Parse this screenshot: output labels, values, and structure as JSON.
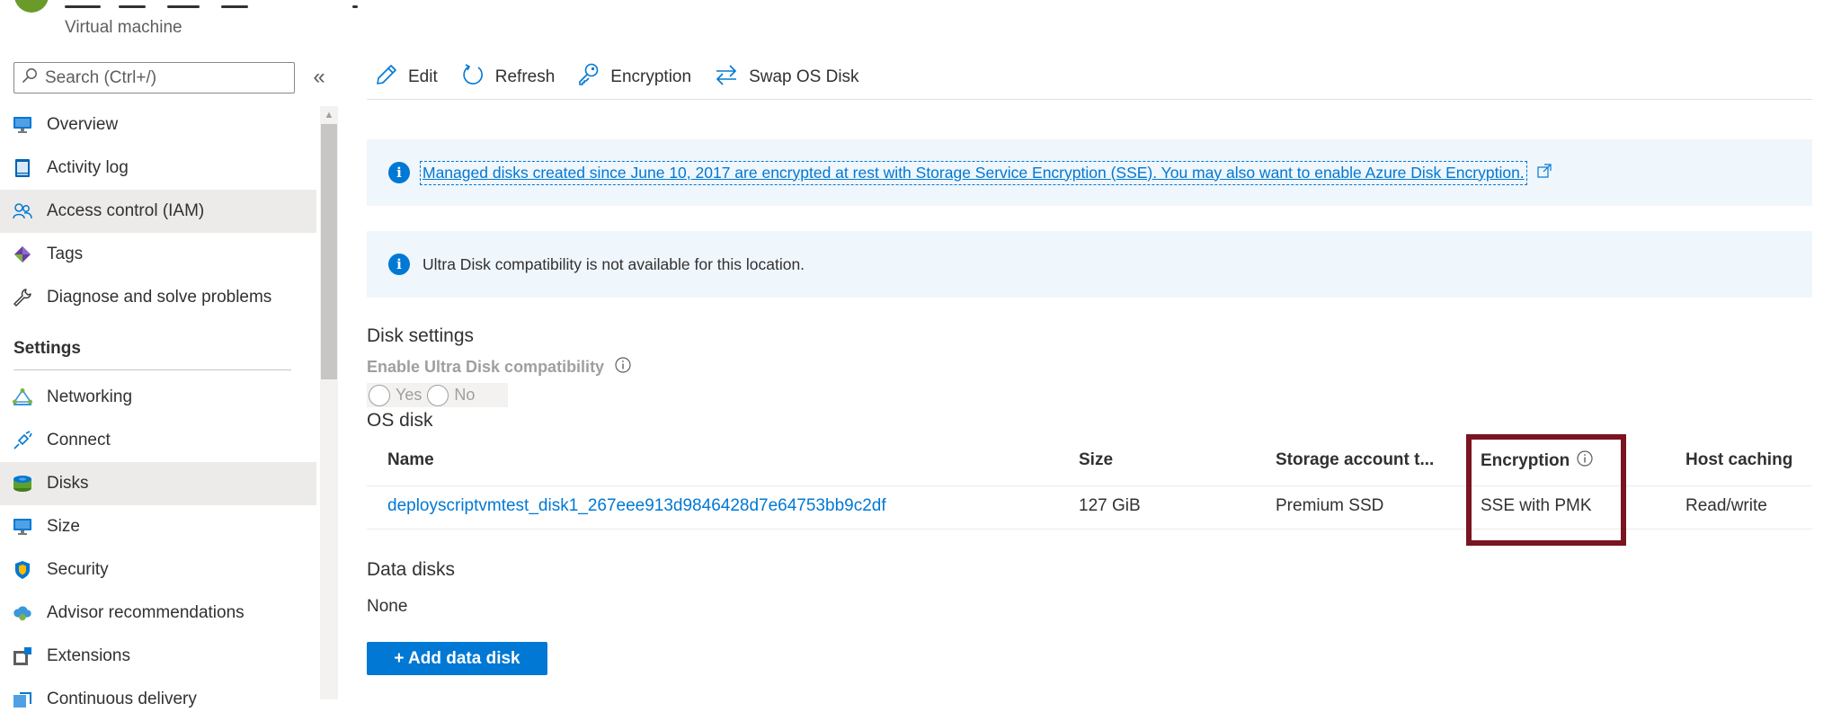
{
  "header": {
    "subtitle": "Virtual machine"
  },
  "sidebar": {
    "search_placeholder": "Search (Ctrl+/)",
    "collapse_glyph": "«",
    "items_top": [
      {
        "label": "Overview",
        "icon": "monitor-icon"
      },
      {
        "label": "Activity log",
        "icon": "activity-log-icon"
      },
      {
        "label": "Access control (IAM)",
        "icon": "people-icon"
      },
      {
        "label": "Tags",
        "icon": "tag-icon"
      },
      {
        "label": "Diagnose and solve problems",
        "icon": "wrench-icon"
      }
    ],
    "section_header": "Settings",
    "items_settings": [
      {
        "label": "Networking",
        "icon": "network-icon"
      },
      {
        "label": "Connect",
        "icon": "plug-icon"
      },
      {
        "label": "Disks",
        "icon": "disk-icon",
        "selected": true
      },
      {
        "label": "Size",
        "icon": "monitor-icon"
      },
      {
        "label": "Security",
        "icon": "shield-icon"
      },
      {
        "label": "Advisor recommendations",
        "icon": "cloud-icon"
      },
      {
        "label": "Extensions",
        "icon": "extensions-icon"
      },
      {
        "label": "Continuous delivery",
        "icon": "delivery-icon"
      }
    ]
  },
  "toolbar": {
    "edit_label": "Edit",
    "refresh_label": "Refresh",
    "encryption_label": "Encryption",
    "swap_label": "Swap OS Disk"
  },
  "banners": {
    "sse_text": "Managed disks created since June 10, 2017 are encrypted at rest with Storage Service Encryption (SSE). You may also want to enable Azure Disk Encryption.",
    "ultra_text": "Ultra Disk compatibility is not available for this location."
  },
  "disk_settings": {
    "title": "Disk settings",
    "ultra_label": "Enable Ultra Disk compatibility",
    "option_yes": "Yes",
    "option_no": "No"
  },
  "os_disk": {
    "title": "OS disk",
    "columns": [
      "Name",
      "Size",
      "Storage account t...",
      "Encryption",
      "Host caching"
    ],
    "row": {
      "name": "deployscriptvmtest_disk1_267eee913d9846428d7e64753bb9c2df",
      "size": "127 GiB",
      "storage": "Premium SSD",
      "encryption": "SSE with PMK",
      "host_caching": "Read/write"
    }
  },
  "data_disks": {
    "title": "Data disks",
    "value": "None",
    "add_button": "+ Add data disk"
  },
  "colors": {
    "accent": "#0078d4",
    "highlight": "#7a1420",
    "banner_bg": "#eff6fc",
    "selected_bg": "#edebe9"
  }
}
